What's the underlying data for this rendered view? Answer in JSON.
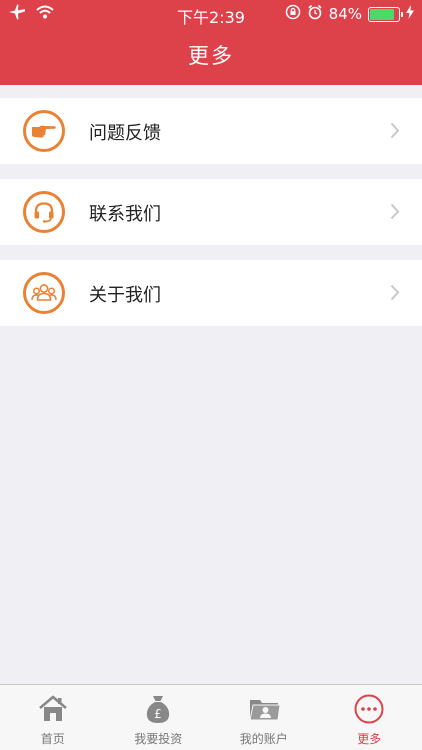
{
  "status_bar": {
    "time": "下午2:39",
    "battery_percent": "84%",
    "battery_level": 0.84
  },
  "header": {
    "title": "更多"
  },
  "menu": [
    {
      "label": "问题反馈",
      "icon": "pointing-hand-icon"
    },
    {
      "label": "联系我们",
      "icon": "headset-icon"
    },
    {
      "label": "关于我们",
      "icon": "people-group-icon"
    }
  ],
  "tabs": [
    {
      "label": "首页",
      "icon": "home-icon",
      "active": false
    },
    {
      "label": "我要投资",
      "icon": "money-bag-icon",
      "active": false
    },
    {
      "label": "我的账户",
      "icon": "account-folder-icon",
      "active": false
    },
    {
      "label": "更多",
      "icon": "more-dots-icon",
      "active": true
    }
  ],
  "colors": {
    "brand_red": "#dd414a",
    "icon_orange": "#e98234",
    "background": "#efeff4"
  }
}
